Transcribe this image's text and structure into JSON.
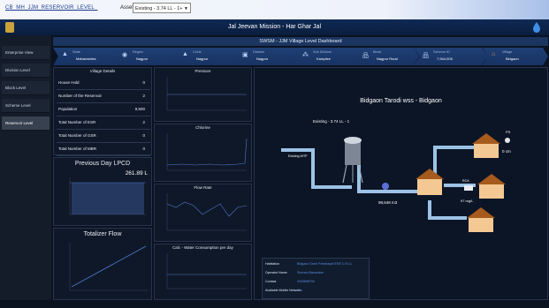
{
  "top": {
    "breadcrumb": "CB_MH_JJM_RESERVOIR_LEVEL_",
    "asset_label": "Asset:",
    "asset_value": "Existing - 3.74 LL - 1+"
  },
  "header": {
    "title": "Jal Jeevan Mission - Har Ghar Jal"
  },
  "sidebar": {
    "items": [
      {
        "label": "Enterprise View"
      },
      {
        "label": "Division Level"
      },
      {
        "label": "Block Level"
      },
      {
        "label": "Scheme Level"
      },
      {
        "label": "Reservoir Level"
      }
    ]
  },
  "dashboard": {
    "title": "SWSM - JJM Village Level Dashboard"
  },
  "hierarchy": [
    {
      "label": "State",
      "value": "Maharashtra"
    },
    {
      "label": "Region",
      "value": "Nagpur"
    },
    {
      "label": "Circle",
      "value": "Nagpur"
    },
    {
      "label": "Division",
      "value": "Nagpur"
    },
    {
      "label": "Sub Division",
      "value": "Kamptee"
    },
    {
      "label": "Block",
      "value": "Nagpur Rural"
    },
    {
      "label": "Scheme ID",
      "value": "7,944,005"
    },
    {
      "label": "Village",
      "value": "Bidgaon"
    }
  ],
  "village_details": {
    "title": "Village Details",
    "rows": [
      {
        "k": "House Hold",
        "v": "0"
      },
      {
        "k": "Number of the Reservoir",
        "v": "2"
      },
      {
        "k": "Population",
        "v": "9,500"
      },
      {
        "k": "Total Number of ESR",
        "v": "2"
      },
      {
        "k": "Total Number of GSR",
        "v": "0"
      },
      {
        "k": "Total Number of MBR",
        "v": "0"
      }
    ]
  },
  "lpcd": {
    "title": "Previous Day LPCD",
    "value": "261.89 L"
  },
  "totalizer": {
    "title": "Totalizer Flow"
  },
  "mini_charts": [
    {
      "title": "Pressure"
    },
    {
      "title": "Chlorine"
    },
    {
      "title": "Flow Rate"
    },
    {
      "title": "Calc - Water Consumption per day"
    }
  ],
  "viz": {
    "place": "Bidgaon Tarodi wss  -  Bidgaon",
    "esr_label": "Existing - 3.74 LL - 1",
    "wtp_label": "Existing WTP",
    "flow_value": "98,648 m3",
    "ps_label": "PS",
    "ps_value": "0 cm",
    "cl_label": "RCA",
    "cl_value": "97 mg/L"
  },
  "info": {
    "rows": [
      {
        "k": "Habitation",
        "v": "Bidgaon Gram Panchayat ESR 3.74 LL"
      },
      {
        "k": "Operator Name",
        "v": "Shriram Basantare"
      },
      {
        "k": "Contact",
        "v": "9325698794"
      },
      {
        "k": "Available Mobile Network",
        "v": "Yes"
      }
    ]
  },
  "colors": {
    "accent": "#1f3f74",
    "chart_line": "#4f79c9",
    "house_roof": "#a65a1c",
    "house_body": "#f3c892",
    "pipe": "#9cc3e6"
  }
}
